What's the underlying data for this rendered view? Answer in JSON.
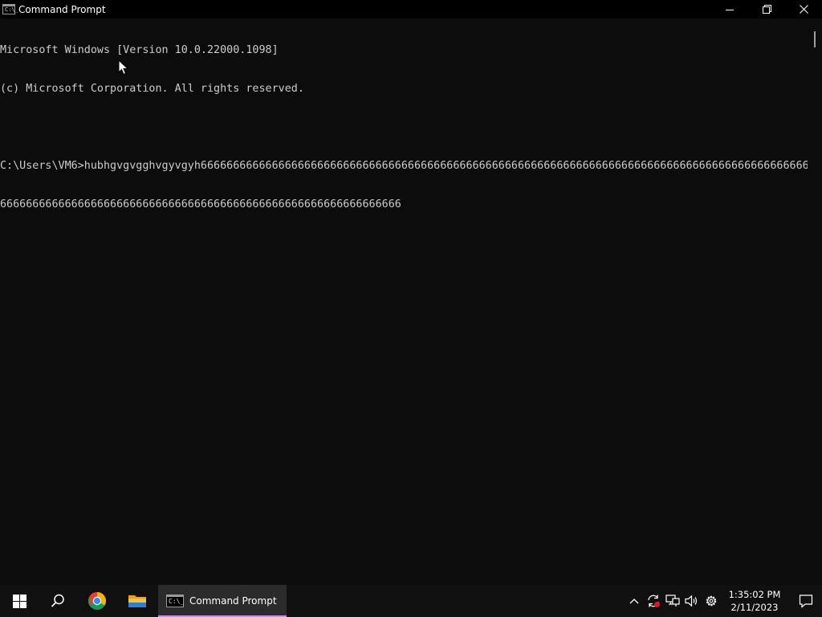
{
  "window": {
    "title": "Command Prompt",
    "icon_glyph": "C:\\_"
  },
  "console": {
    "lines": [
      "Microsoft Windows [Version 10.0.22000.1098]",
      "(c) Microsoft Corporation. All rights reserved.",
      "",
      "C:\\Users\\VM6>hubhgvgvgghvgyvgyh66666666666666666666666666666666666666666666666666666666666666666666666666666666666666666666666666666666",
      "66666666666666666666666666666666666666666666666666666666666666"
    ]
  },
  "taskbar": {
    "apps": [
      {
        "name": "Start",
        "icon": "windows-logo-icon"
      },
      {
        "name": "Search",
        "icon": "search-icon"
      },
      {
        "name": "Google Chrome",
        "icon": "chrome-icon"
      },
      {
        "name": "File Explorer",
        "icon": "folder-icon"
      }
    ],
    "active_app_label": "Command Prompt",
    "active_indicator_color": "#c98fd8",
    "tray": {
      "time": "1:35:02 PM",
      "date": "2/11/2023"
    }
  }
}
